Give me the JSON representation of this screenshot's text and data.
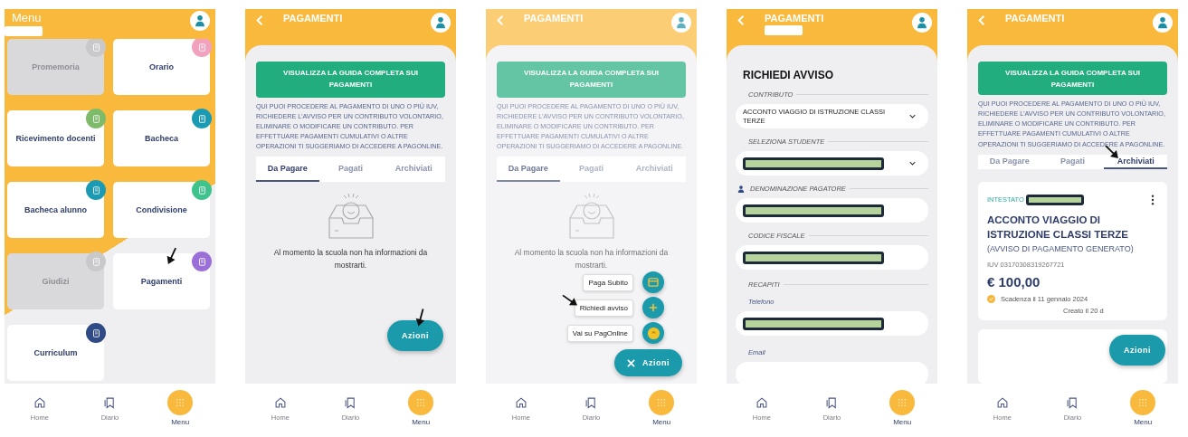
{
  "screens": [
    {
      "kind": "menu",
      "title": "Menu",
      "title_redacted": true,
      "tiles": [
        {
          "label": "Promemoria",
          "disabled": true,
          "color": "#c9c9cb",
          "pointed": false
        },
        {
          "label": "Orario",
          "disabled": false,
          "color": "#f2a1bf",
          "pointed": false
        },
        {
          "label": "Ricevimento docenti",
          "disabled": false,
          "color": "#7dbb6a",
          "pointed": false
        },
        {
          "label": "Bacheca",
          "disabled": false,
          "color": "#1b9bb3",
          "pointed": false
        },
        {
          "label": "Bacheca alunno",
          "disabled": false,
          "color": "#1b9bb3",
          "pointed": false
        },
        {
          "label": "Condivisione",
          "disabled": false,
          "color": "#3fc38d",
          "pointed": false
        },
        {
          "label": "Giudizi",
          "disabled": true,
          "color": "#c9c9cb",
          "pointed": false
        },
        {
          "label": "Pagamenti",
          "disabled": false,
          "color": "#9b6fd8",
          "pointed": true
        },
        {
          "label": "Curriculum",
          "disabled": false,
          "color": "#2f4a85",
          "pointed": false
        }
      ],
      "nav": [
        {
          "label": "Home",
          "selected": false
        },
        {
          "label": "Diario",
          "selected": false
        },
        {
          "label": "Menu",
          "selected": true
        }
      ]
    },
    {
      "kind": "payments",
      "title": "PAGAMENTI",
      "title_redacted": false,
      "guide_button": "VISUALIZZA LA GUIDA COMPLETA SUI PAGAMENTI",
      "intro": "QUI PUOI PROCEDERE AL PAGAMENTO DI UNO O PIÙ IUV, RICHIEDERE L’AVVISO PER UN CONTRIBUTO VOLONTARIO, ELIMINARE O MODIFICARE UN CONTRIBUTO. PER EFFETTUARE PAGAMENTI CUMULATIVI O ALTRE OPERAZIONI TI SUGGERIAMO DI ACCEDERE A PAGONLINE.",
      "tabs": [
        {
          "label": "Da Pagare",
          "selected": true,
          "pointed": false
        },
        {
          "label": "Pagati",
          "selected": false,
          "pointed": false
        },
        {
          "label": "Archiviati",
          "selected": false,
          "pointed": false
        }
      ],
      "empty_message": "Al momento la scuola non ha informazioni da mostrarti.",
      "actions_open": false,
      "fab": {
        "label": "Azioni",
        "pointed": true
      },
      "nav": [
        {
          "label": "Home",
          "selected": false
        },
        {
          "label": "Diario",
          "selected": false
        },
        {
          "label": "Menu",
          "selected": true
        }
      ]
    },
    {
      "kind": "payments",
      "title": "PAGAMENTI",
      "title_redacted": false,
      "guide_button": "VISUALIZZA LA GUIDA COMPLETA SUI PAGAMENTI",
      "intro": "QUI PUOI PROCEDERE AL PAGAMENTO DI UNO O PIÙ IUV, RICHIEDERE L’AVVISO PER UN CONTRIBUTO VOLONTARIO, ELIMINARE O MODIFICARE UN CONTRIBUTO. PER EFFETTUARE PAGAMENTI CUMULATIVI O ALTRE OPERAZIONI TI SUGGERIAMO DI ACCEDERE A PAGONLINE.",
      "tabs": [
        {
          "label": "Da Pagare",
          "selected": true,
          "pointed": false
        },
        {
          "label": "Pagati",
          "selected": false,
          "pointed": false
        },
        {
          "label": "Archiviati",
          "selected": false,
          "pointed": false
        }
      ],
      "empty_message": "Al momento la scuola non ha informazioni da mostrarti.",
      "actions_open": true,
      "actions": [
        {
          "label": "Paga Subito",
          "pointed": false
        },
        {
          "label": "Richiedi avviso",
          "pointed": true
        },
        {
          "label": "Vai su PagOnline",
          "pointed": false
        }
      ],
      "fab": {
        "label": "Azioni",
        "pointed": false
      },
      "nav": [
        {
          "label": "Home",
          "selected": false
        },
        {
          "label": "Diario",
          "selected": false
        },
        {
          "label": "Menu",
          "selected": true
        }
      ]
    },
    {
      "kind": "form",
      "title": "PAGAMENTI",
      "title_redacted": true,
      "form_title": "RICHIEDI AVVISO",
      "fields": [
        {
          "kind": "select",
          "label": "CONTRIBUTO",
          "value": "ACCONTO VIAGGIO DI ISTRUZIONE CLASSI TERZE",
          "redacted": false
        },
        {
          "kind": "select",
          "label": "SELEZIONA STUDENTE",
          "redacted": true
        },
        {
          "kind": "input",
          "label": "DENOMINAZIONE PAGATORE",
          "redacted": true,
          "person_icon": true
        },
        {
          "kind": "input",
          "label": "CODICE FISCALE",
          "redacted": true
        },
        {
          "kind": "section",
          "label": "RECAPITI"
        },
        {
          "kind": "contact",
          "label": "Telefono",
          "redacted": true
        },
        {
          "kind": "contact",
          "label": "Email",
          "redacted": false
        }
      ],
      "nav": [
        {
          "label": "Home",
          "selected": false
        },
        {
          "label": "Diario",
          "selected": false
        },
        {
          "label": "Menu",
          "selected": true
        }
      ]
    },
    {
      "kind": "payments",
      "title": "PAGAMENTI",
      "title_redacted": false,
      "guide_button": "VISUALIZZA LA GUIDA COMPLETA SUI PAGAMENTI",
      "intro": "QUI PUOI PROCEDERE AL PAGAMENTO DI UNO O PIÙ IUV, RICHIEDERE L’AVVISO PER UN CONTRIBUTO VOLONTARIO, ELIMINARE O MODIFICARE UN CONTRIBUTO. PER EFFETTUARE PAGAMENTI CUMULATIVI O ALTRE OPERAZIONI TI SUGGERIAMO DI ACCEDERE A PAGONLINE.",
      "tabs": [
        {
          "label": "Da Pagare",
          "selected": false,
          "pointed": false
        },
        {
          "label": "Pagati",
          "selected": false,
          "pointed": false
        },
        {
          "label": "Archiviati",
          "selected": true,
          "pointed": true
        }
      ],
      "cards": [
        {
          "kind": "payment",
          "owner_label": "INTESTATO",
          "owner_redacted": true,
          "title": "ACCONTO VIAGGIO DI ISTRUZIONE CLASSI TERZE",
          "status": "(AVVISO DI PAGAMENTO GENERATO)",
          "iuv": "IUV 03170308319267721",
          "amount": "€ 100,00",
          "due": "Scadenza il 11 gennaio 2024",
          "created": "Creato il 20 d"
        },
        {
          "kind": "blank"
        }
      ],
      "actions_open": false,
      "fab": {
        "label": "Azioni",
        "pointed": false
      },
      "nav": [
        {
          "label": "Home",
          "selected": false
        },
        {
          "label": "Diario",
          "selected": false
        },
        {
          "label": "Menu",
          "selected": true
        }
      ]
    }
  ]
}
